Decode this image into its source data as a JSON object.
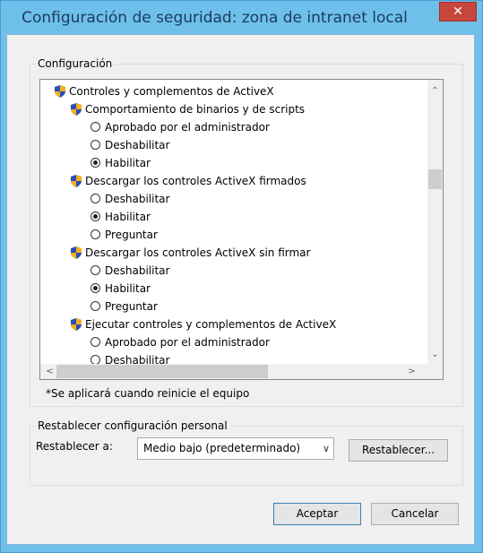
{
  "window": {
    "title": "Configuración de seguridad: zona de intranet local",
    "close_glyph": "✕"
  },
  "settings": {
    "group_label": "Configuración",
    "tree": [
      {
        "kind": "category",
        "icon": "shield-icon",
        "label": "Controles y complementos de ActiveX"
      },
      {
        "kind": "setting",
        "icon": "shield-icon",
        "label": "Comportamiento de binarios y de scripts"
      },
      {
        "kind": "option",
        "label": "Aprobado por el administrador",
        "selected": false
      },
      {
        "kind": "option",
        "label": "Deshabilitar",
        "selected": false
      },
      {
        "kind": "option",
        "label": "Habilitar",
        "selected": true
      },
      {
        "kind": "setting",
        "icon": "shield-icon",
        "label": "Descargar los controles ActiveX firmados"
      },
      {
        "kind": "option",
        "label": "Deshabilitar",
        "selected": false
      },
      {
        "kind": "option",
        "label": "Habilitar",
        "selected": true
      },
      {
        "kind": "option",
        "label": "Preguntar",
        "selected": false
      },
      {
        "kind": "setting",
        "icon": "shield-icon",
        "label": "Descargar los controles ActiveX sin firmar"
      },
      {
        "kind": "option",
        "label": "Deshabilitar",
        "selected": false
      },
      {
        "kind": "option",
        "label": "Habilitar",
        "selected": true
      },
      {
        "kind": "option",
        "label": "Preguntar",
        "selected": false
      },
      {
        "kind": "setting",
        "icon": "shield-icon",
        "label": "Ejecutar controles y complementos de ActiveX"
      },
      {
        "kind": "option",
        "label": "Aprobado por el administrador",
        "selected": false
      },
      {
        "kind": "option",
        "label": "Deshabilitar",
        "selected": false
      }
    ],
    "scroll_arrows": {
      "up": "⌃",
      "down": "⌄",
      "left": "<",
      "right": ">"
    },
    "note": "*Se aplicará cuando reinicie el equipo"
  },
  "reset": {
    "group_label": "Restablecer configuración personal",
    "reset_to_label": "Restablecer a:",
    "selected_level": "Medio bajo (predeterminado)",
    "reset_button": "Restablecer..."
  },
  "buttons": {
    "ok": "Aceptar",
    "cancel": "Cancelar"
  },
  "colors": {
    "title_bar": "#6ec0ea",
    "close_button": "#c7463c",
    "shield_blue": "#2b4fb5",
    "shield_gold": "#f2b01e"
  }
}
